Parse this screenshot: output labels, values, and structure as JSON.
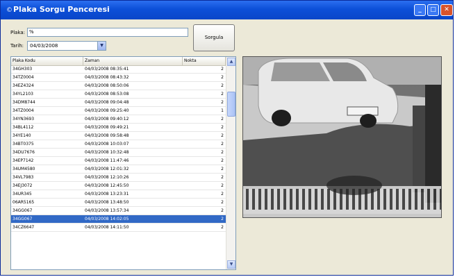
{
  "window": {
    "title": "Plaka Sorgu Penceresi"
  },
  "form": {
    "plaka_label": "Plaka:",
    "plaka_value": "%",
    "tarih_label": "Tarih:",
    "tarih_value": "04/03/2008",
    "sorgula_label": "Sorgula"
  },
  "table": {
    "columns": [
      "Plaka Kodu",
      "Zaman",
      "Nokta"
    ],
    "rows": [
      {
        "plaka": "34GH303",
        "zaman": "04/03/2008 08:35:41",
        "nokta": "2"
      },
      {
        "plaka": "34TZ0004",
        "zaman": "04/03/2008 08:43:32",
        "nokta": "2"
      },
      {
        "plaka": "34EZ4324",
        "zaman": "04/03/2008 08:50:06",
        "nokta": "2"
      },
      {
        "plaka": "34YL2103",
        "zaman": "04/03/2008 08:53:08",
        "nokta": "2"
      },
      {
        "plaka": "34DM8744",
        "zaman": "04/03/2008 09:04:48",
        "nokta": "2"
      },
      {
        "plaka": "34TZ0004",
        "zaman": "04/03/2008 09:25:40",
        "nokta": "1"
      },
      {
        "plaka": "34YN3693",
        "zaman": "04/03/2008 09:40:12",
        "nokta": "2"
      },
      {
        "plaka": "34BL4112",
        "zaman": "04/03/2008 09:49:21",
        "nokta": "2"
      },
      {
        "plaka": "34YE140",
        "zaman": "04/03/2008 09:58:48",
        "nokta": "2"
      },
      {
        "plaka": "34BT0375",
        "zaman": "04/03/2008 10:03:07",
        "nokta": "2"
      },
      {
        "plaka": "34DU7676",
        "zaman": "04/03/2008 10:32:48",
        "nokta": "2"
      },
      {
        "plaka": "34EP7142",
        "zaman": "04/03/2008 11:47:46",
        "nokta": "2"
      },
      {
        "plaka": "34UM4580",
        "zaman": "04/03/2008 12:01:32",
        "nokta": "2"
      },
      {
        "plaka": "34VL7983",
        "zaman": "04/03/2008 12:10:26",
        "nokta": "2"
      },
      {
        "plaka": "34EJ3072",
        "zaman": "04/03/2008 12:45:50",
        "nokta": "2"
      },
      {
        "plaka": "34UR345",
        "zaman": "04/03/2008 13:23:31",
        "nokta": "2"
      },
      {
        "plaka": "06AR5165",
        "zaman": "04/03/2008 13:48:50",
        "nokta": "2"
      },
      {
        "plaka": "34GG067",
        "zaman": "04/03/2008 13:57:34",
        "nokta": "2"
      },
      {
        "plaka": "34GG067",
        "zaman": "04/03/2008 14:02:05",
        "nokta": "2",
        "selected": true
      },
      {
        "plaka": "34CZ6647",
        "zaman": "04/03/2008 14:11:50",
        "nokta": "2"
      }
    ]
  },
  "icons": {
    "window_icon": "app-icon",
    "minimize": "minimize-icon",
    "maximize": "maximize-icon",
    "close": "close-icon",
    "dropdown": "chevron-down-icon",
    "scroll_up": "chevron-up-icon",
    "scroll_down": "chevron-down-icon"
  },
  "colors": {
    "titlebar": "#0c4fd8",
    "selection": "#3169c6",
    "window_bg": "#ece9d8"
  }
}
